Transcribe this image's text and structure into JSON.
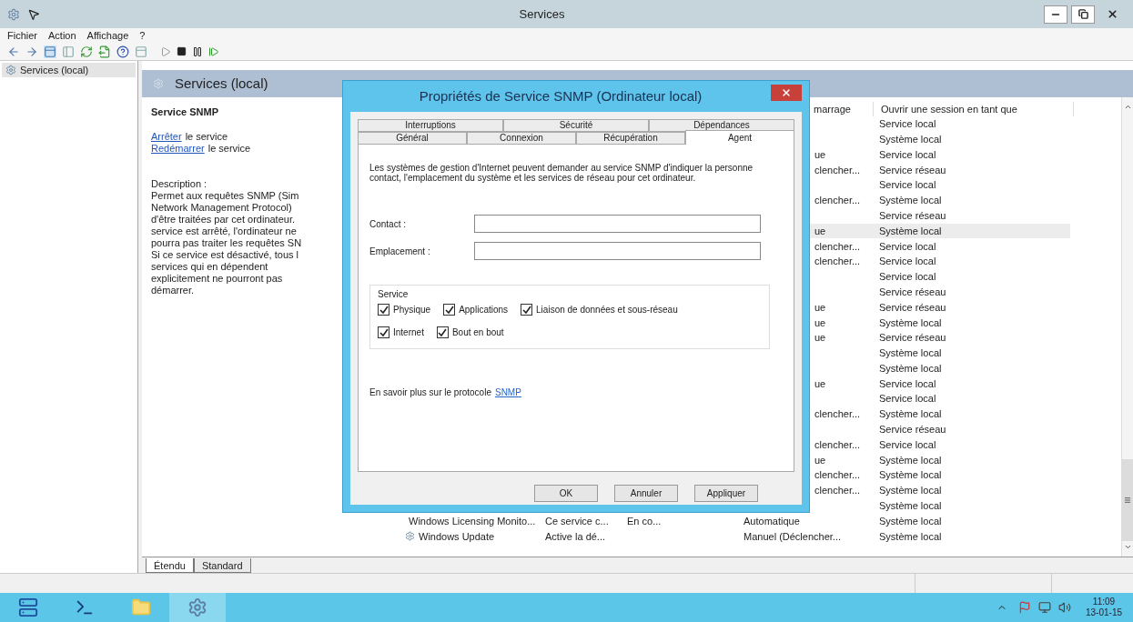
{
  "window": {
    "title": "Services"
  },
  "menu": [
    {
      "label": "Fichier"
    },
    {
      "label": "Action"
    },
    {
      "label": "Affichage"
    },
    {
      "label": "?"
    }
  ],
  "tree": [
    {
      "label": "Services (local)",
      "selected": true
    }
  ],
  "panel": {
    "title": "Services (local)"
  },
  "details": {
    "name": "Service SNMP",
    "actions": [
      {
        "link": "Arrêter",
        "text": "le service"
      },
      {
        "link": "Redémarrer",
        "text": "le service"
      }
    ],
    "description_label": "Description :",
    "description_lines": [
      "Permet aux requêtes SNMP (Sim",
      "Network Management Protocol)",
      "d'être traitées par cet ordinateur.",
      "service est arrêté, l'ordinateur ne",
      "pourra pas traiter les requêtes SN",
      "Si ce service est désactivé, tous l",
      "services qui en dépendent",
      "explicitement ne pourront pas",
      "démarrer."
    ]
  },
  "table": {
    "columns": [
      {
        "label": "marrage"
      },
      {
        "label": "Ouvrir une session en tant que"
      }
    ],
    "rows": [
      {
        "logon": "Service local",
        "selected": false
      },
      {
        "logon": "Système local",
        "selected": false
      },
      {
        "startup": "ue",
        "logon": "Service local",
        "selected": false
      },
      {
        "startup": "clencher...",
        "logon": "Service réseau",
        "selected": false
      },
      {
        "logon": "Service local",
        "selected": false
      },
      {
        "startup": "clencher...",
        "logon": "Système local",
        "selected": false
      },
      {
        "logon": "Service réseau",
        "selected": false
      },
      {
        "startup": "ue",
        "logon": "Système local",
        "selected": true
      },
      {
        "startup": "clencher...",
        "logon": "Service local",
        "selected": false
      },
      {
        "startup": "clencher...",
        "logon": "Service local",
        "selected": false
      },
      {
        "logon": "Service local",
        "selected": false
      },
      {
        "logon": "Service réseau",
        "selected": false
      },
      {
        "startup": "ue",
        "logon": "Service réseau",
        "selected": false
      },
      {
        "startup": "ue",
        "logon": "Système local",
        "selected": false
      },
      {
        "startup": "ue",
        "logon": "Service réseau",
        "selected": false
      },
      {
        "logon": "Système local",
        "selected": false
      },
      {
        "logon": "Système local",
        "selected": false
      },
      {
        "startup": "ue",
        "logon": "Service local",
        "selected": false
      },
      {
        "logon": "Service local",
        "selected": false
      },
      {
        "startup": "clencher...",
        "logon": "Système local",
        "selected": false
      },
      {
        "logon": "Service réseau",
        "selected": false
      },
      {
        "startup": "clencher...",
        "logon": "Service local",
        "selected": false
      },
      {
        "startup": "ue",
        "logon": "Système local",
        "selected": false
      },
      {
        "startup": "clencher...",
        "logon": "Système local",
        "selected": false
      },
      {
        "startup": "clencher...",
        "logon": "Système local",
        "selected": false
      },
      {
        "logon": "Système local",
        "selected": false
      },
      {
        "name": "Windows Licensing Monito...",
        "description": "Ce service c...",
        "status": "En co...",
        "startup": "Automatique",
        "logon": "Système local",
        "selected": false
      },
      {
        "name": "Windows Update",
        "description": "Active la dé...",
        "startup": "Manuel (Déclencher...",
        "logon": "Système local",
        "selected": false
      }
    ]
  },
  "view_tabs": [
    {
      "label": "Étendu",
      "selected": true
    },
    {
      "label": "Standard",
      "selected": false
    }
  ],
  "dialog": {
    "title": "Propriétés de Service SNMP (Ordinateur local)",
    "tab_rows": [
      [
        {
          "label": "Interruptions",
          "selected": false
        },
        {
          "label": "Sécurité",
          "selected": false
        },
        {
          "label": "Dépendances",
          "selected": false
        }
      ],
      [
        {
          "label": "Général",
          "selected": false
        },
        {
          "label": "Connexion",
          "selected": false
        },
        {
          "label": "Récupération",
          "selected": false
        },
        {
          "label": "Agent",
          "selected": true
        }
      ]
    ],
    "intro": "Les systèmes de gestion d'Internet peuvent demander au service SNMP d'indiquer la personne contact, l'emplacement du système et les services de réseau pour cet ordinateur.",
    "fields": [
      {
        "label": "Contact :"
      },
      {
        "label": "Emplacement :"
      }
    ],
    "service_group": {
      "title": "Service",
      "rows": [
        [
          {
            "label": "Physique",
            "checked": true
          },
          {
            "label": "Applications",
            "checked": true
          },
          {
            "label": "Liaison de données et sous-réseau",
            "checked": true
          }
        ],
        [
          {
            "label": "Internet",
            "checked": true
          },
          {
            "label": "Bout en bout",
            "checked": true
          }
        ]
      ]
    },
    "more": {
      "text": "En savoir plus sur le protocole",
      "link": "SNMP"
    },
    "buttons": [
      {
        "label": "OK"
      },
      {
        "label": "Annuler"
      },
      {
        "label": "Appliquer"
      }
    ]
  },
  "taskbar": {
    "apps": [
      {
        "kind": "server",
        "selected": false
      },
      {
        "kind": "shell",
        "selected": false
      },
      {
        "kind": "folder",
        "selected": false
      },
      {
        "kind": "services",
        "selected": true
      }
    ],
    "clock": {
      "time": "11:09",
      "date": "13-01-15"
    }
  }
}
